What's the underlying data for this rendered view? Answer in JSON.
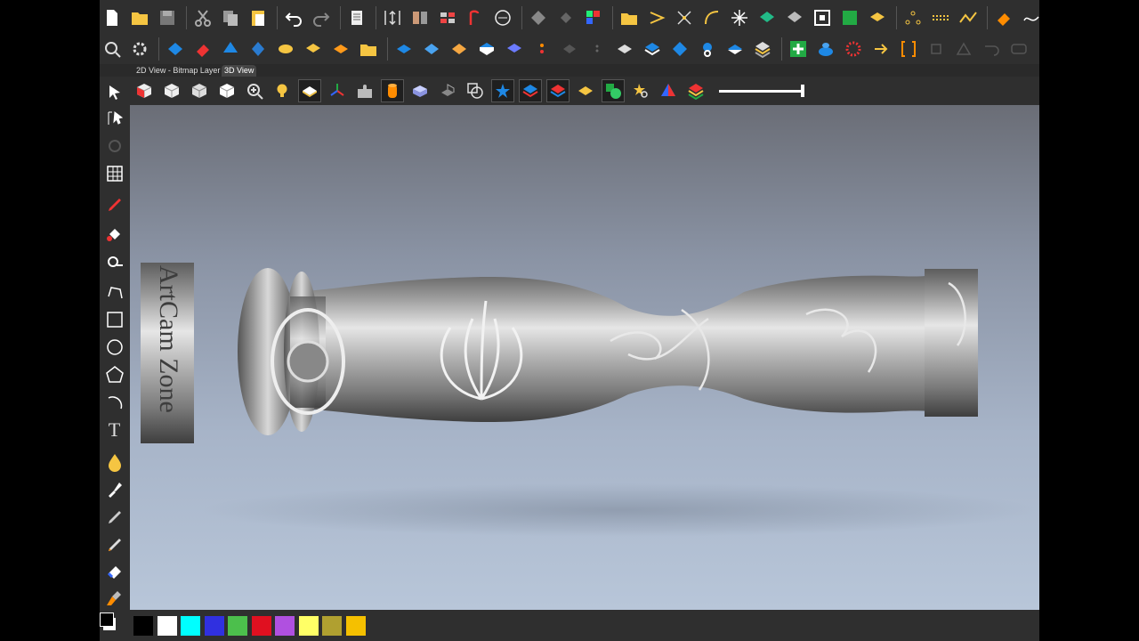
{
  "tabs": [
    {
      "label": "2D View - Bitmap Layer",
      "active": false
    },
    {
      "label": "3D View",
      "active": true
    }
  ],
  "viewport": {
    "model_engraving": "ArtCam Zone",
    "background_top": "#6a6d76",
    "background_bottom": "#b8c6d9"
  },
  "view_toolbar": {
    "slider_level": 1.0
  },
  "palette": {
    "primary_color": "#000000",
    "secondary_color": "#ffffff",
    "swatches": [
      "#000000",
      "#ffffff",
      "#00ffff",
      "#3030e0",
      "#4cbf4c",
      "#e01020",
      "#b050e0",
      "#ffff66",
      "#b0a030",
      "#f5c000"
    ]
  },
  "colors": {
    "app_bg": "#2f2f2f",
    "accent_blue": "#1e88e5",
    "accent_orange": "#ff8c00"
  }
}
